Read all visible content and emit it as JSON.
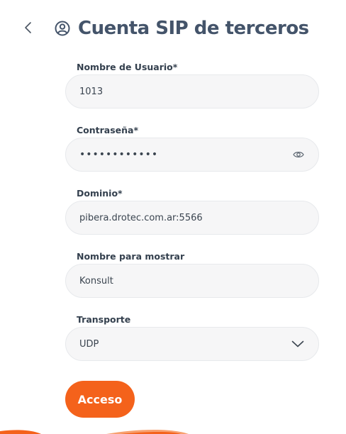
{
  "header": {
    "title": "Cuenta SIP de terceros"
  },
  "form": {
    "username": {
      "label": "Nombre de Usuario*",
      "value": "1013"
    },
    "password": {
      "label": "Contraseña*",
      "value": "••••••••••••"
    },
    "domain": {
      "label": "Dominio*",
      "value": "pibera.drotec.com.ar:5566"
    },
    "display_name": {
      "label": "Nombre para mostrar",
      "value": "Konsult"
    },
    "transport": {
      "label": "Transporte",
      "selected": "UDP"
    },
    "submit_label": "Acceso"
  },
  "icons": {
    "back": "chevron-left-icon",
    "user": "user-circle-icon",
    "password_toggle": "eye-icon",
    "dropdown": "chevron-down-icon"
  },
  "colors": {
    "accent": "#f4621b",
    "title": "#44546a",
    "field_bg": "#f6f6f7"
  }
}
